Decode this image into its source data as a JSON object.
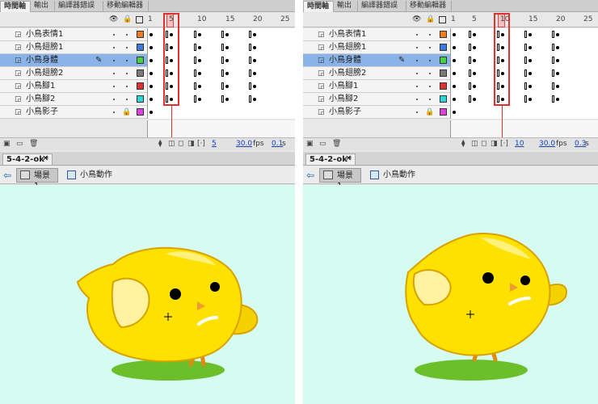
{
  "panel_tabs": [
    "時間軸",
    "輸出",
    "編譯器錯誤",
    "移動編輯器"
  ],
  "frame_numbers": [
    "1",
    "5",
    "10",
    "15",
    "20",
    "25"
  ],
  "layers": [
    {
      "name": "小鳥表情1",
      "color": "#f07b22"
    },
    {
      "name": "小鳥翅膀1",
      "color": "#3b7be0"
    },
    {
      "name": "小鳥身體",
      "color": "#43d343",
      "selected": true
    },
    {
      "name": "小鳥翅膀2",
      "color": "#7a7a7a"
    },
    {
      "name": "小鳥腳1",
      "color": "#e03030"
    },
    {
      "name": "小鳥腳2",
      "color": "#2ad6d6"
    },
    {
      "name": "小鳥影子",
      "color": "#e040e0",
      "locked": true
    }
  ],
  "left": {
    "current_frame": "5",
    "fps": "30.0",
    "fps_unit": "fps",
    "time": "0.1",
    "time_unit": "s",
    "document": "5-4-2-ok*",
    "scene": "場景 1",
    "symbol": "小鳥動作"
  },
  "right": {
    "current_frame": "10",
    "fps": "30.0",
    "fps_unit": "fps",
    "time": "0.3",
    "time_unit": "s",
    "document": "5-4-2-ok*",
    "scene": "場景 1",
    "symbol": "小鳥動作"
  },
  "colors": {
    "stage_bg": "#d6fbf1",
    "highlight": "#e03030",
    "bird_body": "#ffe100",
    "bird_outline": "#d9a200",
    "shadow": "#6bbf2a"
  }
}
